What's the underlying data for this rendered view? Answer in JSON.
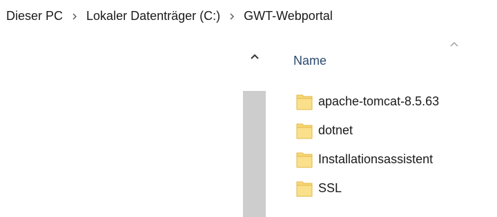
{
  "breadcrumb": {
    "items": [
      {
        "label": "Dieser PC"
      },
      {
        "label": "Lokaler Datenträger (C:)"
      },
      {
        "label": "GWT-Webportal"
      }
    ],
    "separator_icon": "chevron-right-icon"
  },
  "nav_pane": {
    "scroll_up_icon": "caret-up-icon"
  },
  "content": {
    "column_header": "Name",
    "sort_icon": "sort-ascending-icon",
    "items": [
      {
        "name": "apache-tomcat-8.5.63",
        "icon": "folder-icon"
      },
      {
        "name": "dotnet",
        "icon": "folder-icon"
      },
      {
        "name": "Installationsassistent",
        "icon": "folder-icon"
      },
      {
        "name": "SSL",
        "icon": "folder-icon"
      }
    ]
  },
  "colors": {
    "header_text": "#2b4a6f",
    "folder_fill": "#f8d775",
    "folder_edge": "#e0b84a",
    "scroll_thumb": "#cdcdcd"
  }
}
